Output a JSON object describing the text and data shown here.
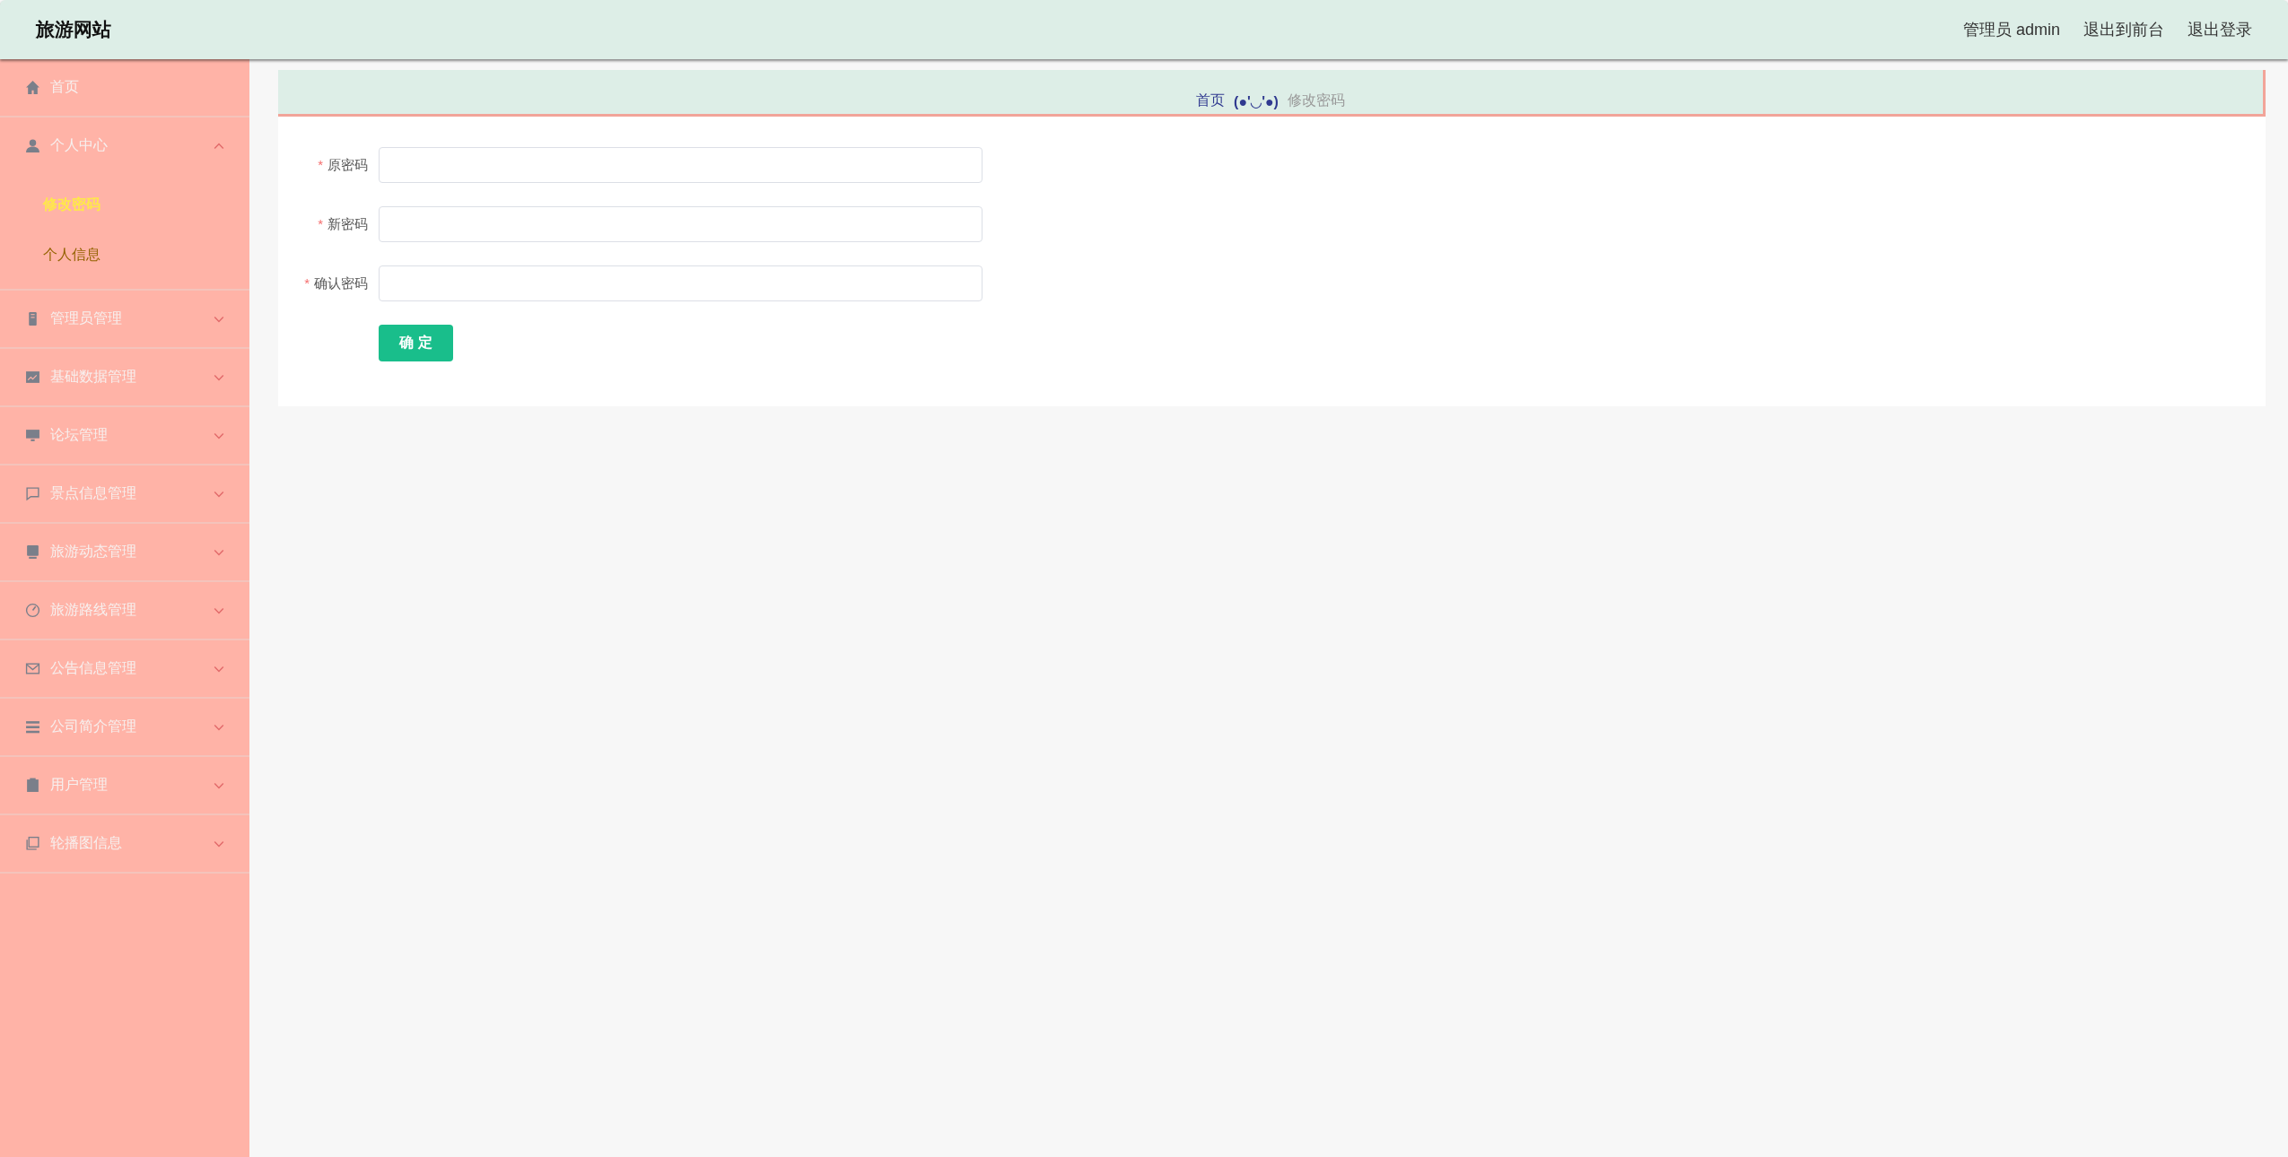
{
  "header": {
    "title": "旅游网站",
    "links": [
      {
        "label": "管理员 admin"
      },
      {
        "label": "退出到前台"
      },
      {
        "label": "退出登录"
      }
    ]
  },
  "sidebar": {
    "items": [
      {
        "label": "首页",
        "kind": "link"
      },
      {
        "label": "个人中心",
        "kind": "menu",
        "expanded": true,
        "children": [
          {
            "label": "修改密码",
            "selected": true
          },
          {
            "label": "个人信息",
            "selected": false
          }
        ]
      },
      {
        "label": "管理员管理",
        "kind": "menu",
        "expanded": false
      },
      {
        "label": "基础数据管理",
        "kind": "menu",
        "expanded": false
      },
      {
        "label": "论坛管理",
        "kind": "menu",
        "expanded": false
      },
      {
        "label": "景点信息管理",
        "kind": "menu",
        "expanded": false
      },
      {
        "label": "旅游动态管理",
        "kind": "menu",
        "expanded": false
      },
      {
        "label": "旅游路线管理",
        "kind": "menu",
        "expanded": false
      },
      {
        "label": "公告信息管理",
        "kind": "menu",
        "expanded": false
      },
      {
        "label": "公司简介管理",
        "kind": "menu",
        "expanded": false
      },
      {
        "label": "用户管理",
        "kind": "menu",
        "expanded": false
      },
      {
        "label": "轮播图信息",
        "kind": "menu",
        "expanded": false
      }
    ]
  },
  "breadcrumb": {
    "items": [
      {
        "label": "首页",
        "current": false
      },
      {
        "label": "修改密码",
        "current": true
      }
    ],
    "separator": "(●'◡'●)"
  },
  "form": {
    "fields": [
      {
        "label": "原密码",
        "marker": "*"
      },
      {
        "label": "新密码",
        "marker": "*"
      },
      {
        "label": "确认密码",
        "marker": "*"
      }
    ],
    "submit": "确 定"
  }
}
